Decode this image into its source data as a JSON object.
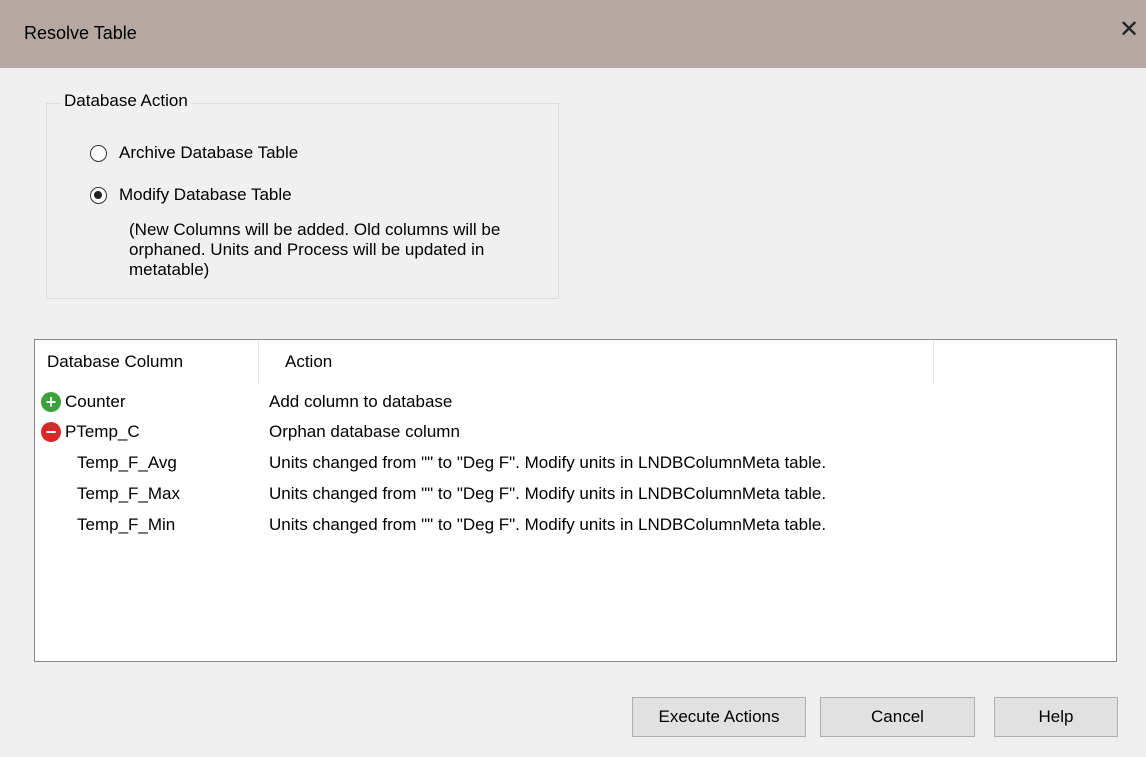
{
  "window": {
    "title": "Resolve Table",
    "close_glyph": "✕"
  },
  "database_action": {
    "legend": "Database Action",
    "options": [
      {
        "label": "Archive Database Table",
        "checked": false
      },
      {
        "label": "Modify Database Table",
        "checked": true
      }
    ],
    "note": "(New Columns will be added.  Old columns will be orphaned.  Units and Process will be updated in metatable)"
  },
  "table": {
    "headers": [
      "Database Column",
      "Action"
    ],
    "rows": [
      {
        "icon": "add-icon",
        "icon_glyph": "+",
        "name": "Counter",
        "action": "Add column to database"
      },
      {
        "icon": "remove-icon",
        "icon_glyph": "−",
        "name": "PTemp_C",
        "action": "Orphan database column"
      },
      {
        "icon": "",
        "name": "Temp_F_Avg",
        "action": "Units changed from \"\" to \"Deg F\". Modify units in LNDBColumnMeta table."
      },
      {
        "icon": "",
        "name": "Temp_F_Max",
        "action": "Units changed from \"\" to \"Deg F\". Modify units in LNDBColumnMeta table."
      },
      {
        "icon": "",
        "name": "Temp_F_Min",
        "action": "Units changed from \"\" to \"Deg F\". Modify units in LNDBColumnMeta table."
      }
    ]
  },
  "buttons": {
    "execute": "Execute Actions",
    "cancel": "Cancel",
    "help": "Help"
  },
  "colors": {
    "titlebar": "#b5a7a2",
    "add_icon": "#3aa23a",
    "remove_icon": "#d42a2a"
  }
}
